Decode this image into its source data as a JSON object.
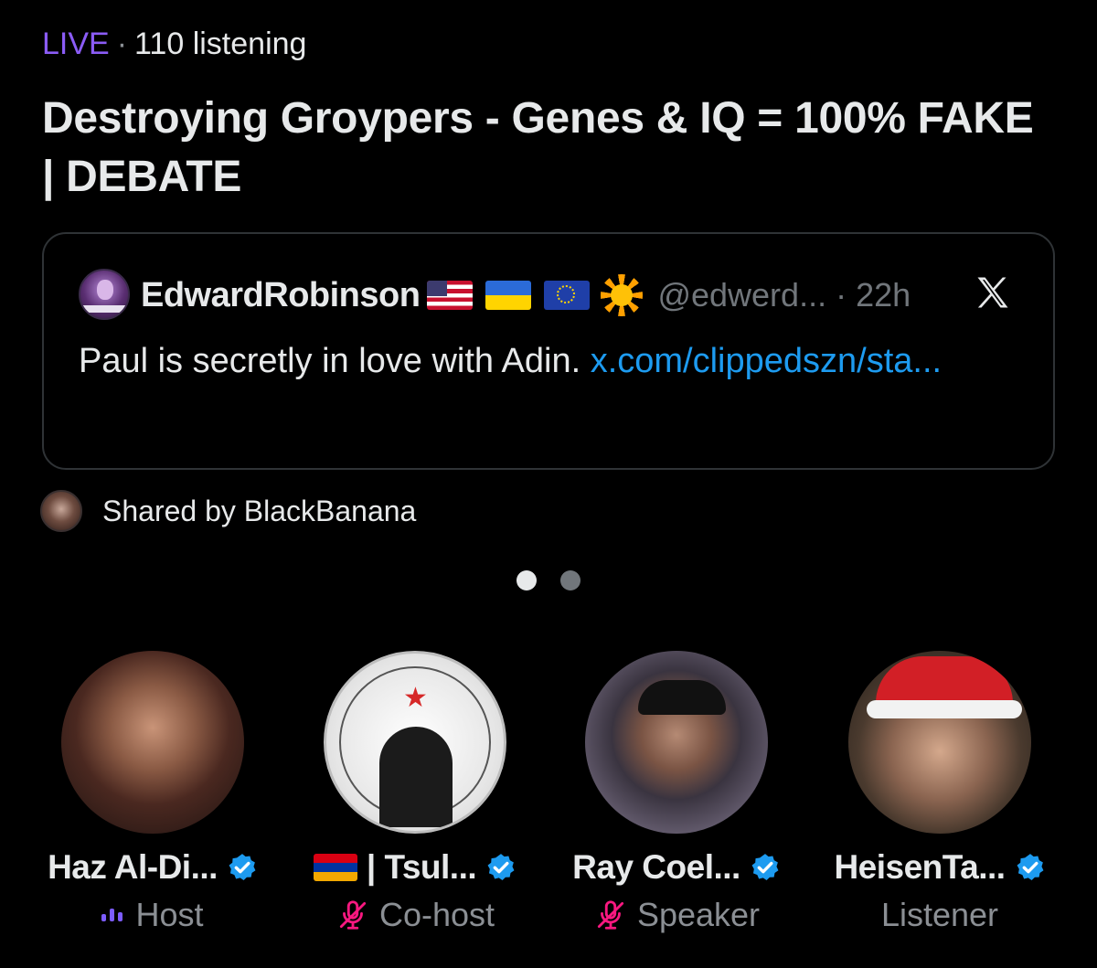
{
  "space": {
    "live_label": "LIVE",
    "separator": "·",
    "listening": "110 listening",
    "title": "Destroying Groypers - Genes & IQ = 100% FAKE | DEBATE"
  },
  "tweet": {
    "author_name": "EdwardRobinson",
    "handle": "@edwerd... · 22h",
    "text": "Paul is secretly in love with Adin. ",
    "link": "x.com/clippedszn/sta...",
    "flags": [
      "us-flag",
      "ukraine-flag",
      "eu-flag",
      "sun-emoji"
    ],
    "brand_icon": "x-logo-icon"
  },
  "shared": {
    "text": "Shared by BlackBanana"
  },
  "pager": {
    "count": 2,
    "active": 0
  },
  "participants": [
    {
      "name": "Haz Al-Di...",
      "role": "Host",
      "role_icon": "speaking-bars-icon",
      "verified": true
    },
    {
      "name": "| Tsul...",
      "role": "Co-host",
      "role_icon": "mic-muted-icon",
      "verified": true,
      "name_prefix_flag": "armenia-flag"
    },
    {
      "name": "Ray Coel...",
      "role": "Speaker",
      "role_icon": "mic-muted-icon",
      "verified": true
    },
    {
      "name": "HeisenTa...",
      "role": "Listener",
      "role_icon": "",
      "verified": true
    }
  ],
  "colors": {
    "background": "#000000",
    "live": "#8b5cf6",
    "link": "#1d9bf0",
    "verified": "#1d9bf0",
    "muted_mic": "#f91880",
    "secondary_text": "#8b8f94"
  }
}
